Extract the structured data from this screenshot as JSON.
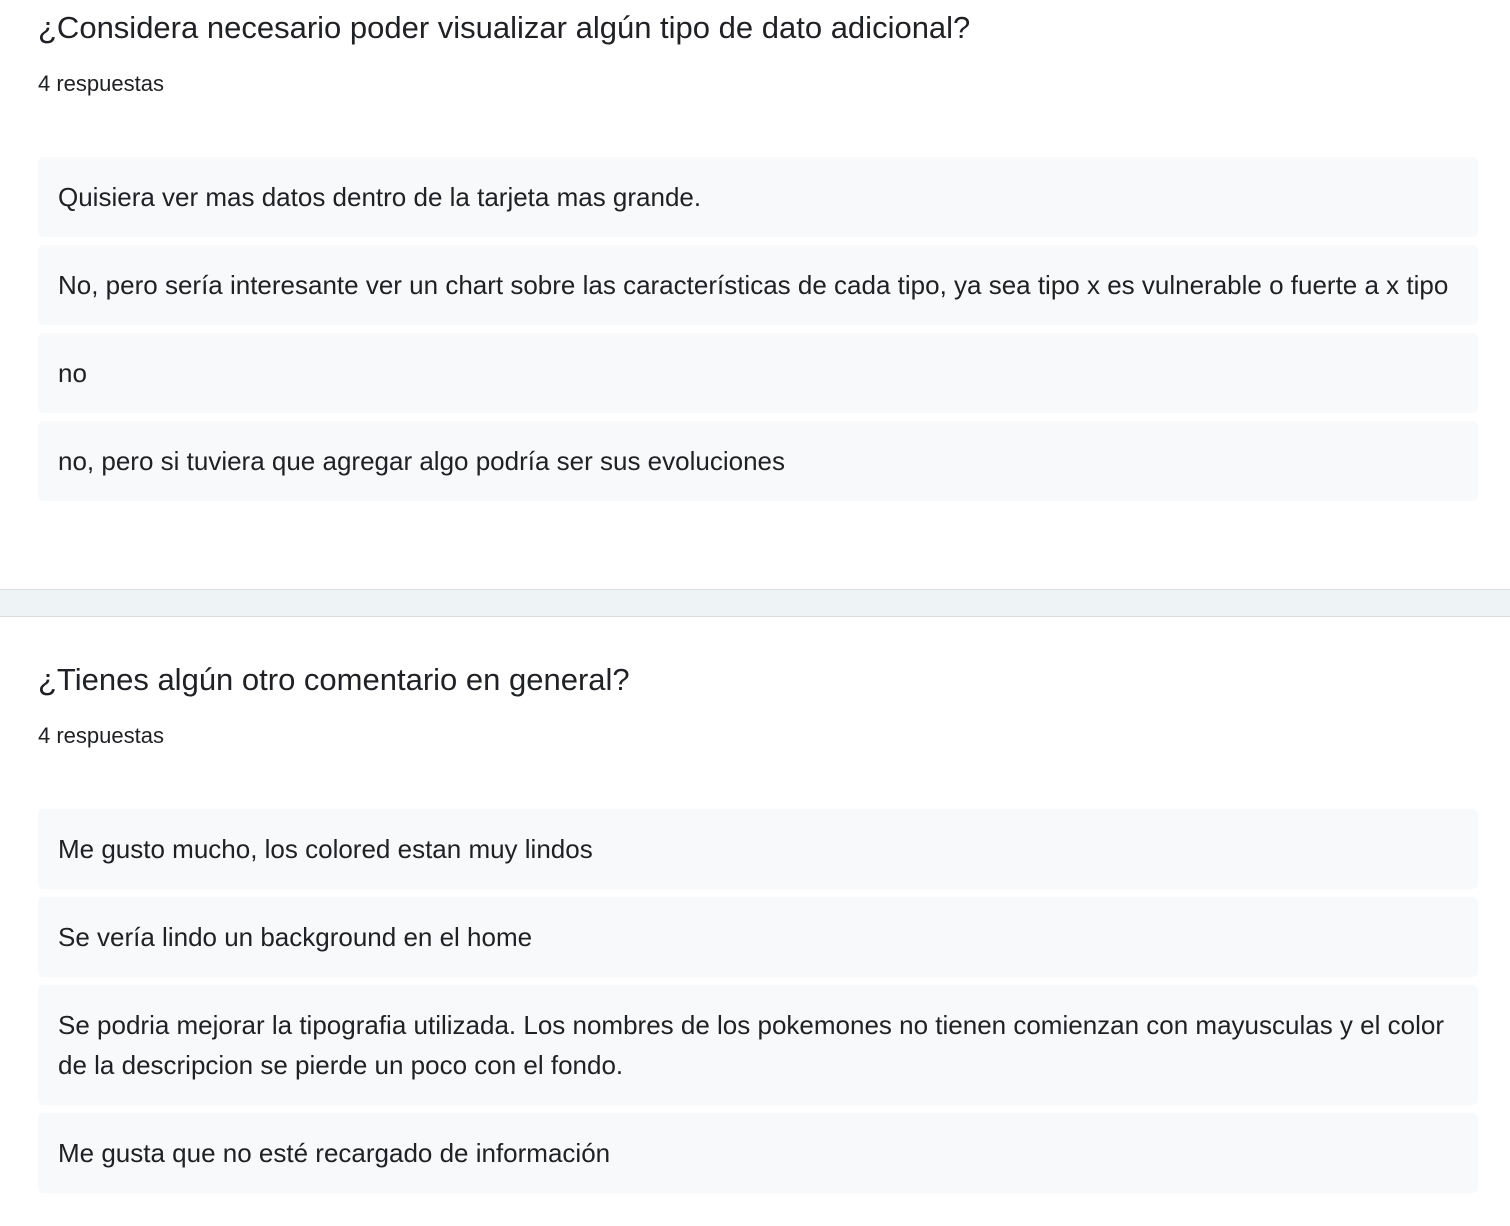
{
  "questions": [
    {
      "title": "¿Considera necesario poder visualizar algún tipo de dato adicional?",
      "count": "4 respuestas",
      "responses": [
        "Quisiera ver mas datos dentro de la tarjeta mas grande.",
        "No, pero sería interesante ver un chart sobre las características de cada tipo, ya sea tipo x es vulnerable o fuerte a x tipo",
        "no",
        "no, pero si tuviera que agregar algo podría ser sus evoluciones"
      ]
    },
    {
      "title": "¿Tienes algún otro comentario en general?",
      "count": "4 respuestas",
      "responses": [
        "Me gusto mucho, los colored estan muy lindos",
        "Se vería lindo un background en el home",
        "Se podria mejorar la tipografia utilizada. Los nombres de los pokemones no tienen comienzan con mayusculas y el color de la descripcion se pierde un poco con el fondo.",
        "Me gusta que no esté recargado de información"
      ]
    }
  ]
}
